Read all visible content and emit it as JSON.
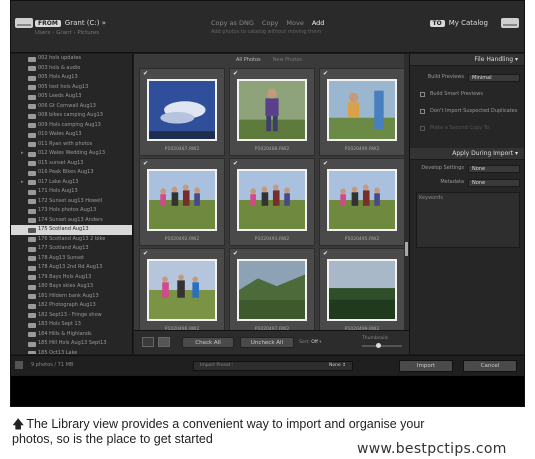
{
  "topbar": {
    "from_badge": "FROM",
    "from_source": "Grant (C:) »",
    "from_sub": "Users › Grant › Pictures",
    "modes": [
      "Copy as DNG",
      "Copy",
      "Move",
      "Add"
    ],
    "active_mode": "Add",
    "modes_sub": "Add photos to catalog without moving them",
    "to_badge": "TO",
    "to_label": "My Catalog"
  },
  "folders": [
    {
      "label": "002 hols updates"
    },
    {
      "label": "003 hols & audio"
    },
    {
      "label": "005 Hols Aug13"
    },
    {
      "label": "005 test hols Aug13"
    },
    {
      "label": "005 Leeds Aug13"
    },
    {
      "label": "006 Gt Cornwall Aug13"
    },
    {
      "label": "008 bikes camping Aug13"
    },
    {
      "label": "009 Hols camping Aug13"
    },
    {
      "label": "010 Wales Aug13"
    },
    {
      "label": "011 Ryan with photos"
    },
    {
      "label": "012 Wales Wedding Aug13",
      "arrow": true
    },
    {
      "label": "015 sunset Aug13"
    },
    {
      "label": "016 Peak Bikes Aug13"
    },
    {
      "label": "017 Lake Aug13",
      "arrow": true
    },
    {
      "label": "171 Hols Aug13"
    },
    {
      "label": "172 Sunset aug13 Howell"
    },
    {
      "label": "173 Hols photos Aug13"
    },
    {
      "label": "174 Sunset aug13 Anders"
    },
    {
      "label": "175 Scotland Aug13",
      "selected": true
    },
    {
      "label": "176 Scotland Aug13 2 bike"
    },
    {
      "label": "177 Scotland Aug13"
    },
    {
      "label": "178 Aug13 Sunset"
    },
    {
      "label": "178 Aug13 2nd Rd Aug13"
    },
    {
      "label": "179 Bays Hols Aug13"
    },
    {
      "label": "180 Bays skies Aug13"
    },
    {
      "label": "181 Hildern bank Aug13"
    },
    {
      "label": "182 Photograph Aug13"
    },
    {
      "label": "182 Sept13 - Fringe show"
    },
    {
      "label": "183 Hols Sept 13"
    },
    {
      "label": "184 Hills & Highlands"
    },
    {
      "label": "185 Hill Hols Aug13 Sept13"
    },
    {
      "label": "185 Oct13 Lake"
    },
    {
      "label": "186 Hols Oct13"
    }
  ],
  "grid": {
    "tab_all": "All Photos",
    "tab_new": "New Photos",
    "thumbs": [
      {
        "cap": "P1020487.RW2",
        "scene": "sky"
      },
      {
        "cap": "P1020488.RW2",
        "scene": "child"
      },
      {
        "cap": "P1020490.RW2",
        "scene": "child2"
      },
      {
        "cap": "P1020492.RW2",
        "scene": "group"
      },
      {
        "cap": "P1020493.RW2",
        "scene": "group"
      },
      {
        "cap": "P1020495.RW2",
        "scene": "group"
      },
      {
        "cap": "P1020496.RW2",
        "scene": "group2"
      },
      {
        "cap": "P1020497.RW2",
        "scene": "valley"
      },
      {
        "cap": "P1020499.RW2",
        "scene": "forest"
      }
    ]
  },
  "gridbar": {
    "check_all": "Check All",
    "uncheck_all": "Uncheck All",
    "sort_label": "Sort",
    "sort_value": "Off",
    "thumbnails_label": "Thumbnails"
  },
  "right": {
    "file_handling": "File Handling",
    "build_previews_label": "Build Previews",
    "build_previews_value": "Minimal",
    "smart_previews": "Build Smart Previews",
    "no_duplicates": "Don't Import Suspected Duplicates",
    "second_copy": "Make a Second Copy To:",
    "apply_during_import": "Apply During Import",
    "develop_settings_label": "Develop Settings",
    "develop_settings_value": "None",
    "metadata_label": "Metadata",
    "metadata_value": "None",
    "keywords_label": "Keywords"
  },
  "bottom": {
    "count": "9 photos / 71 MB",
    "preset_label": "Import Preset :",
    "preset_value": "None ↕",
    "import": "Import",
    "cancel": "Cancel"
  },
  "caption": {
    "line1": "The Library view provides a convenient way to import and organise your",
    "line2": "photos, so is the place to get started"
  },
  "watermark": "www.bestpctips.com"
}
